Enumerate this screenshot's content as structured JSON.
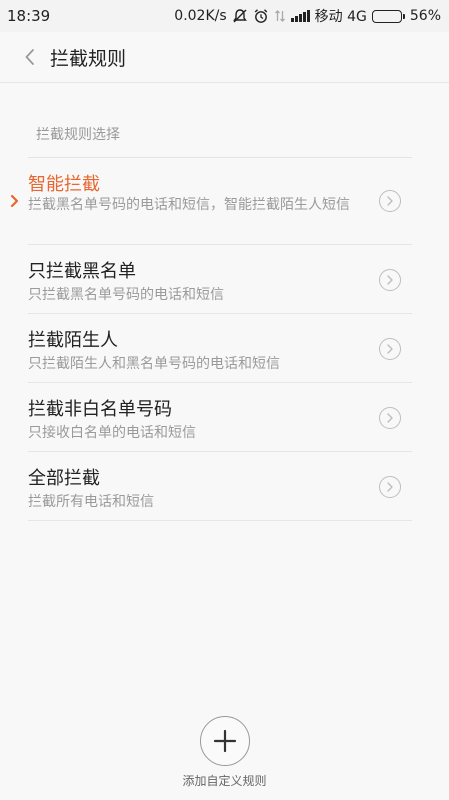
{
  "status_bar": {
    "time": "18:39",
    "net_speed": "0.02K/s",
    "carrier": "移动 4G",
    "battery": "56%",
    "battery_level": 0.56,
    "icons": [
      "silent-icon",
      "alarm-icon",
      "data-arrows-icon",
      "signal-icon",
      "battery-icon"
    ]
  },
  "header": {
    "title": "拦截规则",
    "back_icon": "back-chevron-icon"
  },
  "section": {
    "label": "拦截规则选择"
  },
  "rules": [
    {
      "title": "智能拦截",
      "desc": "拦截黑名单号码的电话和短信，智能拦截陌生人短信",
      "selected": true
    },
    {
      "title": "只拦截黑名单",
      "desc": "只拦截黑名单号码的电话和短信",
      "selected": false
    },
    {
      "title": "拦截陌生人",
      "desc": "只拦截陌生人和黑名单号码的电话和短信",
      "selected": false
    },
    {
      "title": "拦截非白名单号码",
      "desc": "只接收白名单的电话和短信",
      "selected": false
    },
    {
      "title": "全部拦截",
      "desc": "拦截所有电话和短信",
      "selected": false
    }
  ],
  "add_button": {
    "label": "添加自定义规则",
    "icon": "plus-icon"
  },
  "colors": {
    "accent": "#e8662f",
    "text": "#222222",
    "secondary_text": "#9a9a9a"
  }
}
